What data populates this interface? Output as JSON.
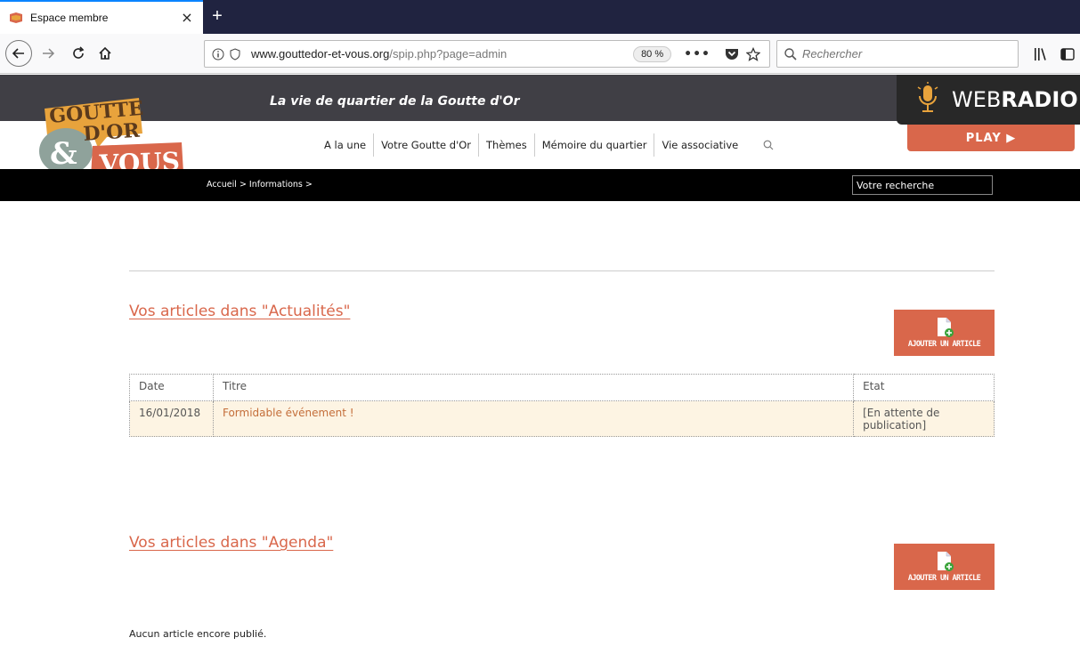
{
  "browser": {
    "tab_title": "Espace membre",
    "tab_close": "×",
    "new_tab": "+",
    "url_domain": "www.gouttedor-et-vous.org",
    "url_path": "/spip.php?page=admin",
    "zoom": "80 %",
    "more": "•••",
    "search_placeholder": "Rechercher"
  },
  "site": {
    "tagline": "La vie de quartier de la Goutte d'Or",
    "logo_words": [
      "GOUTTE",
      "D'OR",
      "&",
      "VOUS"
    ],
    "menu": [
      "A la une",
      "Votre Goutte d'Or",
      "Thèmes",
      "Mémoire du quartier",
      "Vie associative"
    ],
    "webradio_light": "WEB",
    "webradio_bold": "RADIO",
    "play": "PLAY ▶",
    "breadcrumb": "Accueil > Informations >",
    "search_placeholder": "Votre recherche"
  },
  "sections": [
    {
      "title": "Vos articles dans \"Actualités\"",
      "add_label": "AJOUTER UN ARTICLE",
      "columns": [
        "Date",
        "Titre",
        "Etat"
      ],
      "rows": [
        {
          "date": "16/01/2018",
          "title": "Formidable événement !",
          "state": "[En attente de publication]"
        }
      ]
    },
    {
      "title": "Vos articles dans \"Agenda\"",
      "add_label": "AJOUTER UN ARTICLE",
      "empty": "Aucun article encore publié."
    }
  ],
  "colors": {
    "accent": "#d9674b",
    "header_dark": "#403f45",
    "row_bg": "#fdf4e3"
  }
}
